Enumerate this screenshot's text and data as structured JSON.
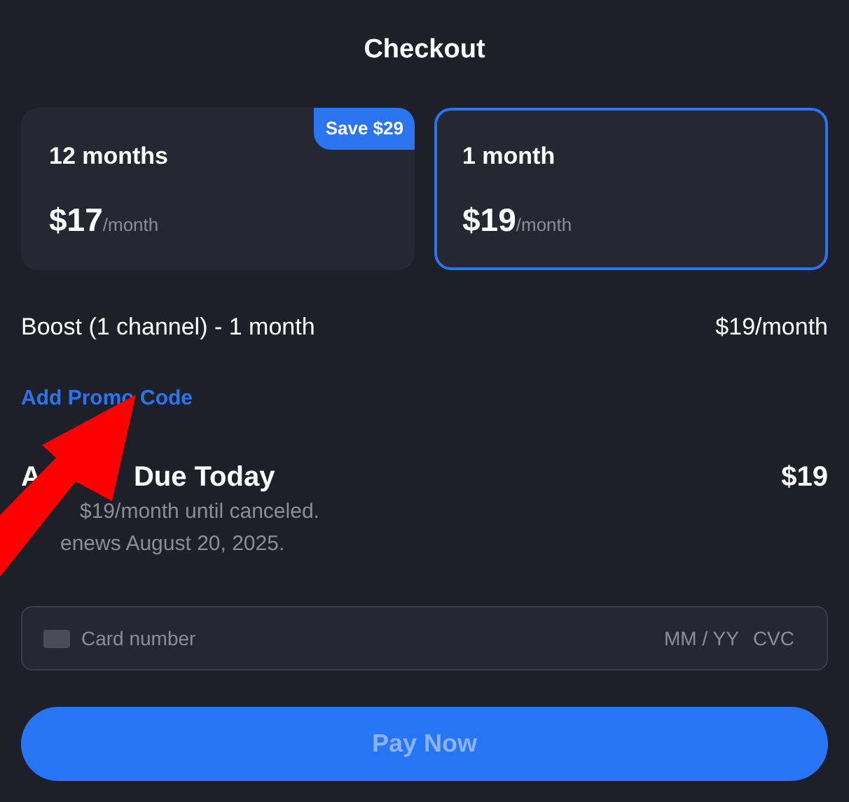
{
  "title": "Checkout",
  "plans": [
    {
      "term": "12 months",
      "price": "$17",
      "period": "/month",
      "badge": "Save $29",
      "selected": false
    },
    {
      "term": "1 month",
      "price": "$19",
      "period": "/month",
      "selected": true
    }
  ],
  "line_item": {
    "label": "Boost (1 channel) - 1 month",
    "amount": "$19/month"
  },
  "promo_link": "Add Promo Code",
  "amount_due": {
    "heading_fragments": [
      "A",
      "Due Today"
    ],
    "amount": "$19",
    "notes": [
      "$19/month until canceled.",
      "enews August 20, 2025."
    ]
  },
  "card_field": {
    "placeholder": "Card number",
    "expiry_placeholder": "MM / YY",
    "cvc_placeholder": "CVC"
  },
  "pay_button": {
    "label": "Pay Now",
    "disabled": true
  }
}
